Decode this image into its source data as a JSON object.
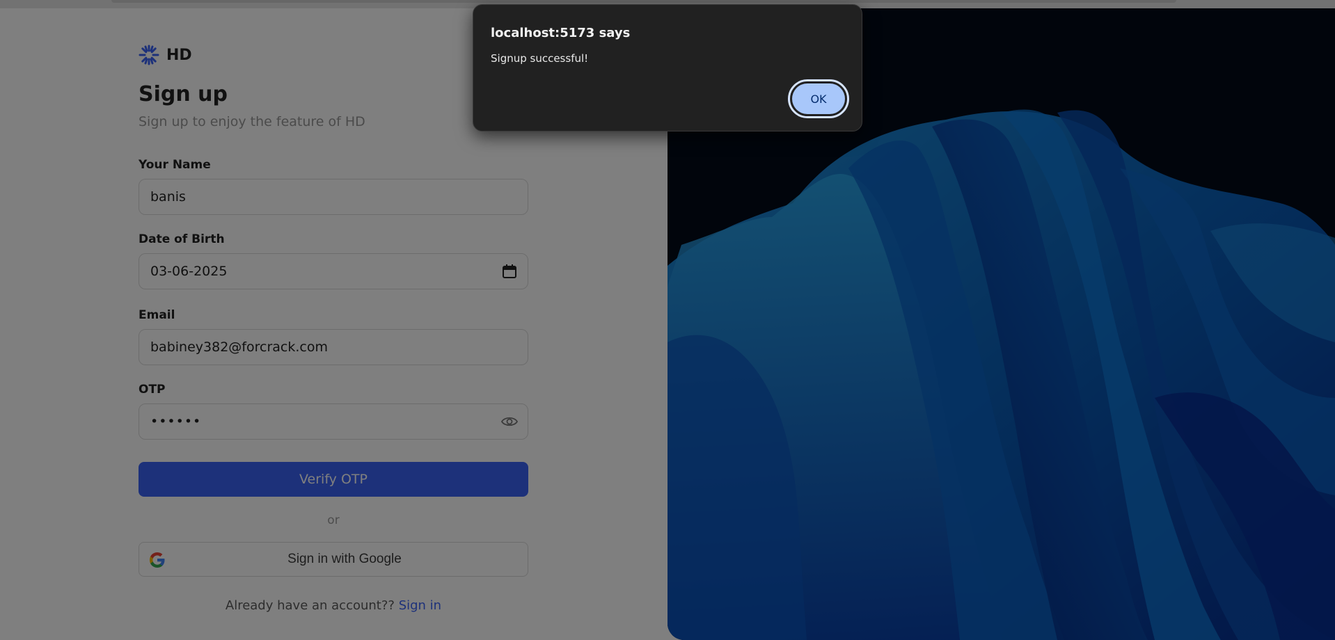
{
  "brand": {
    "name": "HD",
    "accent": "#3b63f5"
  },
  "signup": {
    "title": "Sign up",
    "subtitle": "Sign up to enjoy the feature of HD",
    "fields": {
      "name": {
        "label": "Your Name",
        "value": "banis"
      },
      "dob": {
        "label": "Date of Birth",
        "value": "03-06-2025",
        "icon": "calendar-icon"
      },
      "email": {
        "label": "Email",
        "value": "babiney382@forcrack.com"
      },
      "otp": {
        "label": "OTP",
        "value": "••••••",
        "icon": "eye-icon"
      }
    },
    "verify_button": "Verify OTP",
    "or_text": "or",
    "google_button": "Sign in with Google",
    "footer_text": "Already have an account??",
    "footer_link": "Sign in"
  },
  "alert": {
    "title": "localhost:5173 says",
    "message": "Signup successful!",
    "ok_label": "OK"
  }
}
